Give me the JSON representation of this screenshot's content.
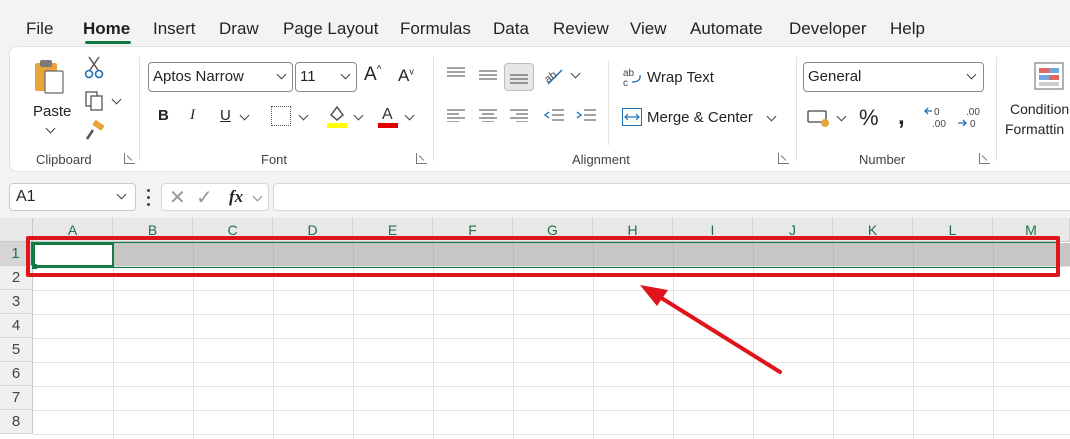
{
  "menu": {
    "tabs": [
      "File",
      "Home",
      "Insert",
      "Draw",
      "Page Layout",
      "Formulas",
      "Data",
      "Review",
      "View",
      "Automate",
      "Developer",
      "Help"
    ],
    "active": "Home"
  },
  "ribbon": {
    "clipboard": {
      "paste_label": "Paste",
      "group_label": "Clipboard"
    },
    "font": {
      "family": "Aptos Narrow",
      "size": "11",
      "group_label": "Font",
      "fill_color": "#ffff00",
      "font_color": "#e00000"
    },
    "alignment": {
      "wrap_label": "Wrap Text",
      "merge_label": "Merge & Center",
      "group_label": "Alignment"
    },
    "number": {
      "format": "General",
      "group_label": "Number"
    },
    "styles": {
      "cond_label_1": "Condition",
      "cond_label_2": "Formattin"
    }
  },
  "formula_bar": {
    "name_box": "A1",
    "fx": "fx",
    "formula": ""
  },
  "grid": {
    "columns": [
      "A",
      "B",
      "C",
      "D",
      "E",
      "F",
      "G",
      "H",
      "I",
      "J",
      "K",
      "L",
      "M"
    ],
    "rows": [
      "1",
      "2",
      "3",
      "4",
      "5",
      "6",
      "7",
      "8"
    ],
    "selected_row": "1",
    "active_cell": "A1"
  },
  "annotation": {
    "color": "#e0141b"
  }
}
